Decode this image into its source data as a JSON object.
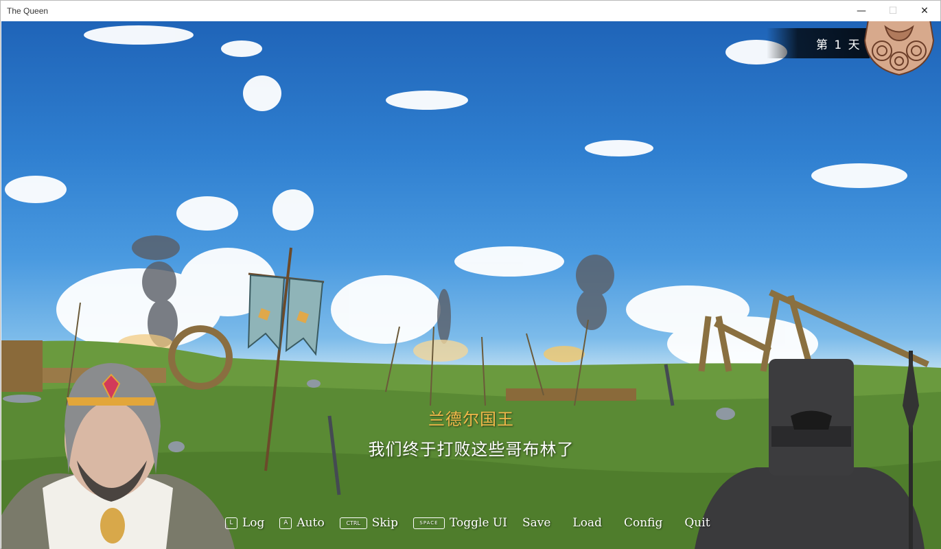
{
  "window": {
    "title": "The Queen",
    "minimize_glyph": "—",
    "maximize_glyph": "☐",
    "close_glyph": "✕"
  },
  "hud": {
    "day_label": "第 1 天"
  },
  "dialogue": {
    "speaker": "兰德尔国王",
    "text": "我们终于打败这些哥布林了"
  },
  "quick_menu": [
    {
      "key": "L",
      "label": "Log"
    },
    {
      "key": "A",
      "label": "Auto"
    },
    {
      "key": "CTRL",
      "label": "Skip"
    },
    {
      "key": "SPACE",
      "label": "Toggle UI"
    },
    {
      "label": "Save"
    },
    {
      "label": "Load"
    },
    {
      "label": "Config"
    },
    {
      "label": "Quit"
    }
  ],
  "colors": {
    "speaker_name": "#f1b84a",
    "sky": "#2f7fd0",
    "grass": "#5e8f3a"
  }
}
